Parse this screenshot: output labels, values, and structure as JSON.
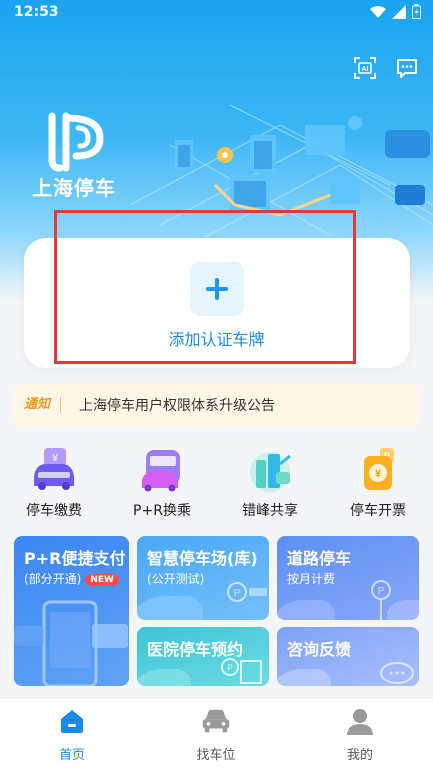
{
  "status_bar": {
    "time": "12:53"
  },
  "header": {
    "logo_text": "上海停车",
    "scan_icon": "ai-scan-icon",
    "message_icon": "chat-icon"
  },
  "plate_card": {
    "add_label": "添加认证车牌"
  },
  "notice": {
    "tag": "通知",
    "text": "上海停车用户权限体系升级公告"
  },
  "quick_menu": [
    {
      "label": "停车缴费",
      "icon": "parking-pay-icon"
    },
    {
      "label": "P+R换乘",
      "icon": "pr-transfer-icon"
    },
    {
      "label": "错峰共享",
      "icon": "off-peak-share-icon"
    },
    {
      "label": "停车开票",
      "icon": "parking-invoice-icon"
    }
  ],
  "features": {
    "pr_pay": {
      "title": "P+R便捷支付",
      "subtitle": "(部分开通)",
      "badge": "NEW"
    },
    "smart_lot": {
      "title": "智慧停车场(库)",
      "subtitle": "(公开测试)"
    },
    "road_parking": {
      "title": "道路停车",
      "subtitle": "按月计费"
    },
    "hospital": {
      "title": "医院停车预约"
    },
    "feedback": {
      "title": "咨询反馈"
    }
  },
  "bottom_nav": [
    {
      "label": "首页",
      "icon": "home-icon",
      "active": true
    },
    {
      "label": "找车位",
      "icon": "car-icon",
      "active": false
    },
    {
      "label": "我的",
      "icon": "user-icon",
      "active": false
    }
  ],
  "colors": {
    "primary": "#1a8ce8",
    "highlight": "#e03a3a",
    "notice_bg": "#fff6e6",
    "notice_tag": "#f29a1e"
  }
}
